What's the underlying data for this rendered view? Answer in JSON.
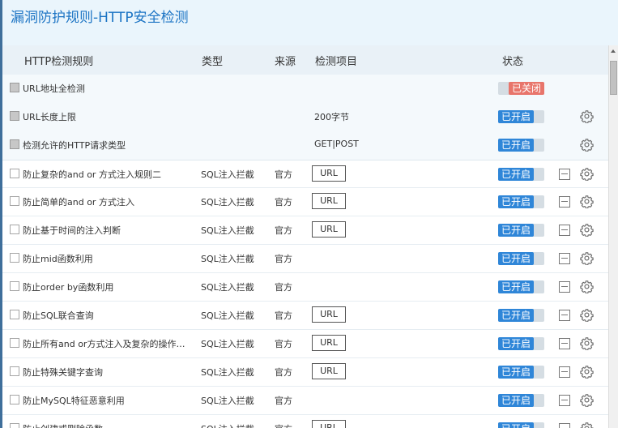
{
  "page": {
    "title": "漏洞防护规则-HTTP安全检测"
  },
  "table": {
    "headers": {
      "rule": "HTTP检测规则",
      "type": "类型",
      "source": "来源",
      "item": "检测项目",
      "status": "状态"
    },
    "rows": [
      {
        "name": "URL地址全检测",
        "type": "",
        "source": "",
        "item": "",
        "item_kind": "none",
        "status": "已关闭",
        "enabled": false,
        "system": true,
        "has_gear": false
      },
      {
        "name": "URL长度上限",
        "type": "",
        "source": "",
        "item": "200字节",
        "item_kind": "text",
        "status": "已开启",
        "enabled": true,
        "system": true,
        "has_gear": true
      },
      {
        "name": "检测允许的HTTP请求类型",
        "type": "",
        "source": "",
        "item": "GET|POST",
        "item_kind": "text",
        "status": "已开启",
        "enabled": true,
        "system": true,
        "has_gear": true
      },
      {
        "name": "防止复杂的and or 方式注入规则二",
        "type": "SQL注入拦截",
        "source": "官方",
        "item": "URL",
        "item_kind": "button",
        "status": "已开启",
        "enabled": true,
        "system": false,
        "has_gear": true
      },
      {
        "name": "防止简单的and or 方式注入",
        "type": "SQL注入拦截",
        "source": "官方",
        "item": "URL",
        "item_kind": "button",
        "status": "已开启",
        "enabled": true,
        "system": false,
        "has_gear": true
      },
      {
        "name": "防止基于时间的注入判断",
        "type": "SQL注入拦截",
        "source": "官方",
        "item": "URL",
        "item_kind": "button",
        "status": "已开启",
        "enabled": true,
        "system": false,
        "has_gear": true
      },
      {
        "name": "防止mid函数利用",
        "type": "SQL注入拦截",
        "source": "官方",
        "item": "",
        "item_kind": "none",
        "status": "已开启",
        "enabled": true,
        "system": false,
        "has_gear": true
      },
      {
        "name": "防止order by函数利用",
        "type": "SQL注入拦截",
        "source": "官方",
        "item": "",
        "item_kind": "none",
        "status": "已开启",
        "enabled": true,
        "system": false,
        "has_gear": true
      },
      {
        "name": "防止SQL联合查询",
        "type": "SQL注入拦截",
        "source": "官方",
        "item": "URL",
        "item_kind": "button",
        "status": "已开启",
        "enabled": true,
        "system": false,
        "has_gear": true
      },
      {
        "name": "防止所有and or方式注入及复杂的操作符...",
        "type": "SQL注入拦截",
        "source": "官方",
        "item": "URL",
        "item_kind": "button",
        "status": "已开启",
        "enabled": true,
        "system": false,
        "has_gear": true
      },
      {
        "name": "防止特殊关键字查询",
        "type": "SQL注入拦截",
        "source": "官方",
        "item": "URL",
        "item_kind": "button",
        "status": "已开启",
        "enabled": true,
        "system": false,
        "has_gear": true
      },
      {
        "name": "防止MySQL特征恶意利用",
        "type": "SQL注入拦截",
        "source": "官方",
        "item": "",
        "item_kind": "none",
        "status": "已开启",
        "enabled": true,
        "system": false,
        "has_gear": true
      },
      {
        "name": "防止创建或删除函数",
        "type": "SQL注入拦截",
        "source": "官方",
        "item": "URL",
        "item_kind": "button",
        "status": "已开启",
        "enabled": true,
        "system": false,
        "has_gear": true
      }
    ]
  },
  "icons": {
    "gear": "gear-icon",
    "delete": "minus-icon"
  },
  "colors": {
    "title": "#1c74c4",
    "enabled": "#2f86d8",
    "disabled": "#e8756b"
  }
}
